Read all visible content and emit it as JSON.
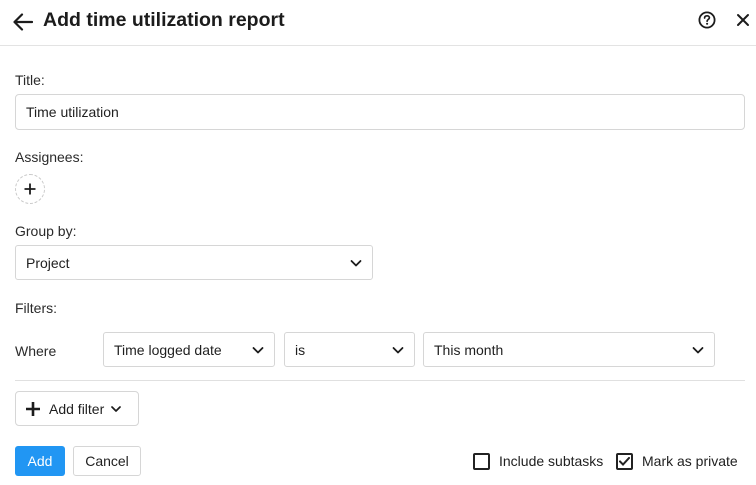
{
  "header": {
    "title": "Add time utilization report",
    "back_icon": "arrow-left-icon",
    "help_icon": "question-circle-icon",
    "close_icon": "close-icon"
  },
  "form": {
    "title_label": "Title:",
    "title_value": "Time utilization",
    "assignees_label": "Assignees:",
    "group_by_label": "Group by:",
    "group_by_value": "Project",
    "filters_label": "Filters:",
    "filter": {
      "where_label": "Where",
      "field": "Time logged date",
      "operator": "is",
      "value": "This month"
    },
    "add_filter_label": "Add filter"
  },
  "footer": {
    "add_label": "Add",
    "cancel_label": "Cancel",
    "include_subtasks_label": "Include subtasks",
    "include_subtasks_checked": false,
    "mark_private_label": "Mark as private",
    "mark_private_checked": true
  },
  "colors": {
    "primary": "#2196f3",
    "border": "#d6d6d6"
  }
}
